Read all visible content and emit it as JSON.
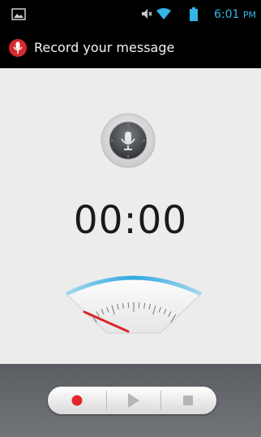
{
  "status_bar": {
    "time": "6:01",
    "suffix": "PM",
    "icons": [
      "picture-notification-icon",
      "mute-icon",
      "wifi-icon",
      "battery-icon"
    ]
  },
  "app": {
    "title": "Record your message",
    "icon": "record-app-icon"
  },
  "recorder": {
    "timer": "00:00",
    "level": 0
  },
  "controls": {
    "buttons": [
      "record",
      "play",
      "stop"
    ],
    "record_color": "#e0262b",
    "disabled_color": "#b5b5b5"
  },
  "colors": {
    "accent": "#33b5e5",
    "background": "#ececec",
    "control_bar": "#6a6e72"
  }
}
